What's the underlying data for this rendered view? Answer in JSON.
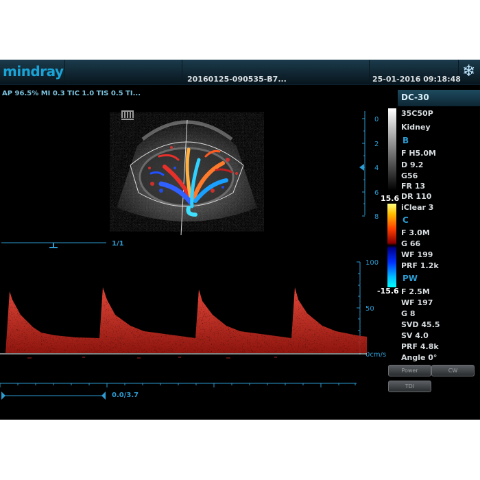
{
  "header": {
    "brand": "mindray",
    "study_id": "20160125-090535-B7...",
    "datetime": "25-01-2016 09:18:48",
    "freeze_icon": "snowflake-icon"
  },
  "acoustic_output": "AP 96.5%  MI 0.3 TIC 1.0 TIS 0.5 TI...",
  "depth_scale": {
    "ticks": [
      "0",
      "2",
      "4",
      "6",
      "8"
    ]
  },
  "pw_scale": {
    "ticks": [
      "100",
      "50",
      "0cm/s"
    ]
  },
  "zoom_indicator": "1/1",
  "sweep_indicator": "0.0/3.7",
  "panel": {
    "title": "DC-30",
    "probe": "35C50P",
    "exam": "Kidney",
    "b_heading": "B",
    "b_params": [
      "F H5.0M",
      "D 9.2",
      "G56",
      "FR 13",
      "DR 110",
      "iClear 3"
    ],
    "c_heading": "C",
    "c_params": [
      "F 3.0M",
      "G 66",
      "WF 199",
      "PRF 1.2k"
    ],
    "pw_heading": "PW",
    "pw_params": [
      "F 2.5M",
      "WF 197",
      "G 8",
      "SVD 45.5",
      "SV 4.0",
      "PRF 4.8k",
      "Angle 0°"
    ],
    "velocity_max": "15.6",
    "velocity_min": "-15.6"
  },
  "buttons": {
    "power": "Power",
    "cw": "CW",
    "tdi": "TDI"
  },
  "colors": {
    "accent": "#2d9cd2",
    "brand": "#1aa3d6",
    "doppler": "#e8302a"
  }
}
